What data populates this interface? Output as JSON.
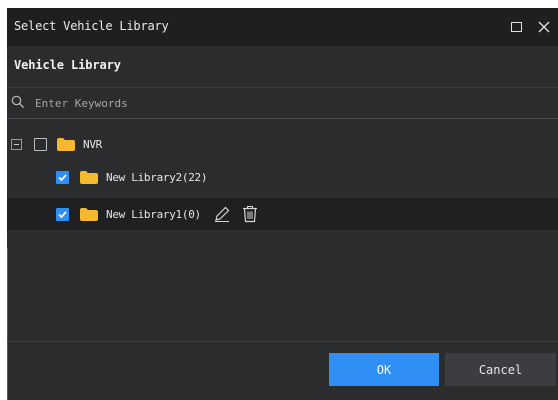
{
  "window": {
    "title": "Select Vehicle Library",
    "icons": {
      "maximize": "maximize-icon",
      "close": "close-icon"
    }
  },
  "section": {
    "header": "Vehicle Library"
  },
  "search": {
    "placeholder": "Enter Keywords",
    "value": "",
    "icon": "search-icon"
  },
  "tree": {
    "root": {
      "label": "NVR",
      "expanded": true,
      "checked": false,
      "icon": "folder-icon"
    },
    "children": [
      {
        "label": "New Library2(22)",
        "checked": true,
        "icon": "folder-icon"
      },
      {
        "label": "New Library1(0)",
        "checked": true,
        "icon": "folder-icon",
        "selected": true,
        "actions": [
          "edit-icon",
          "delete-icon"
        ]
      }
    ]
  },
  "buttons": {
    "ok": "OK",
    "cancel": "Cancel"
  },
  "colors": {
    "dialog_bg": "#2b2c2e",
    "titlebar_bg": "#1e1f21",
    "accent": "#2f8ff5",
    "folder": "#f5b82e",
    "selected_row_bg": "#1f2022",
    "cancel_bg": "#3c3d40"
  }
}
